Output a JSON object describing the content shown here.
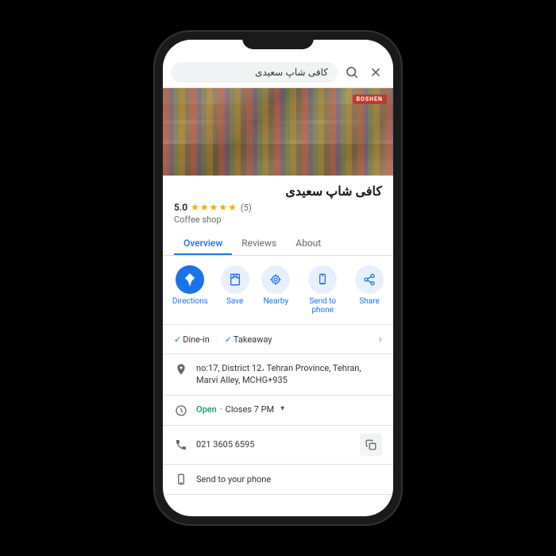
{
  "phone": {
    "search_placeholder": "کافی شاپ سعیدی",
    "search_value": "کافی شاپ سعیدی"
  },
  "place": {
    "name": "کافی شاپ سعیدی",
    "rating": "5.0",
    "stars_count": 5,
    "review_count": "(5)",
    "type": "Coffee shop",
    "boshen_label": "BOSHEN",
    "tabs": [
      {
        "id": "overview",
        "label": "Overview",
        "active": true
      },
      {
        "id": "reviews",
        "label": "Reviews",
        "active": false
      },
      {
        "id": "about",
        "label": "About",
        "active": false
      }
    ],
    "actions": [
      {
        "id": "directions",
        "label": "Directions",
        "icon": "◈",
        "type": "directions"
      },
      {
        "id": "save",
        "label": "Save",
        "icon": "🔖"
      },
      {
        "id": "nearby",
        "label": "Nearby",
        "icon": "◎"
      },
      {
        "id": "send_to_phone",
        "label": "Send to phone",
        "icon": "📱"
      },
      {
        "id": "share",
        "label": "Share",
        "icon": "↗"
      }
    ],
    "features": [
      {
        "label": "Dine-in"
      },
      {
        "label": "Takeaway"
      }
    ],
    "address": "no:17, District 12، Tehran Province, Tehran, Marvi Alley, MCHG+935",
    "hours_status": "Open",
    "hours_close": "Closes 7 PM",
    "phone_number": "021 3605 6595",
    "send_to_phone_label": "Send to your phone"
  }
}
